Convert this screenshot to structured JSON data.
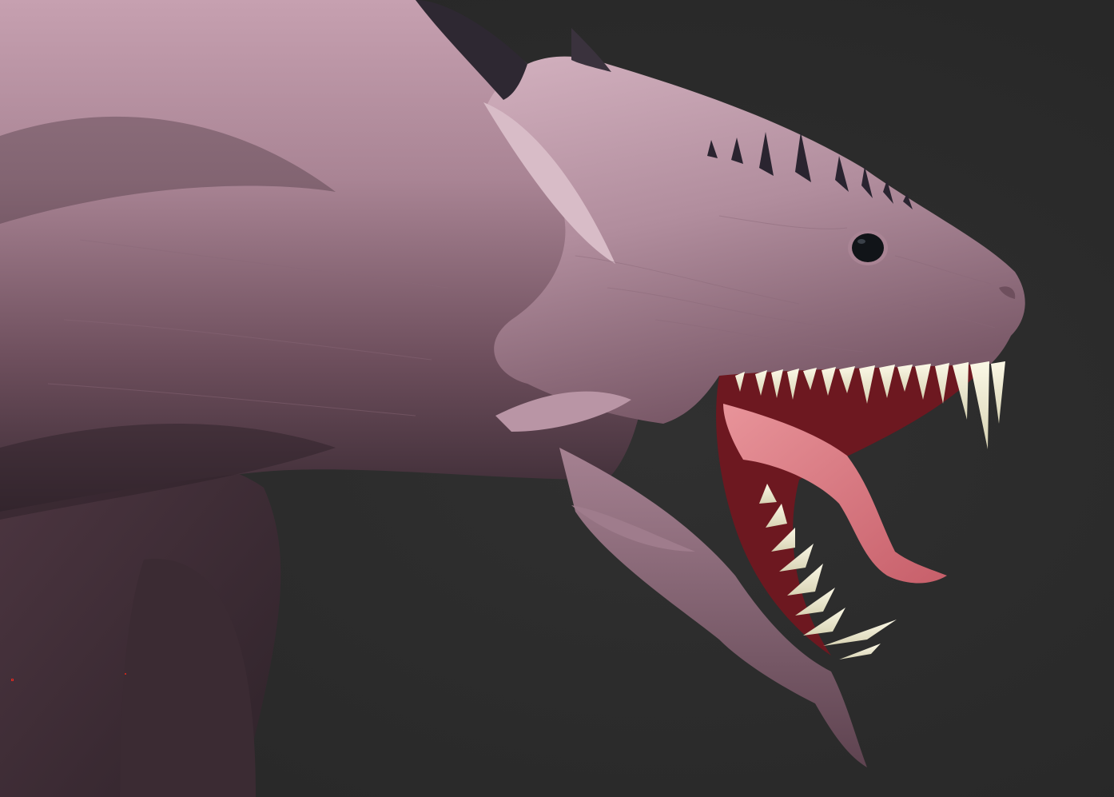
{
  "viewport": {
    "background_color": "#2b2b2b",
    "subject": "sculpted-creature-head"
  },
  "colors": {
    "skin_light": "#c9a3b3",
    "skin_mid": "#9a7585",
    "skin_dark": "#4a3440",
    "spike": "#2e2832",
    "tooth": "#f2efd8",
    "tongue": "#d9767e",
    "mouth_interior": "#7a1a22",
    "eye": "#111418"
  },
  "icons": [
    "viewport-pivot-marker-icon"
  ]
}
